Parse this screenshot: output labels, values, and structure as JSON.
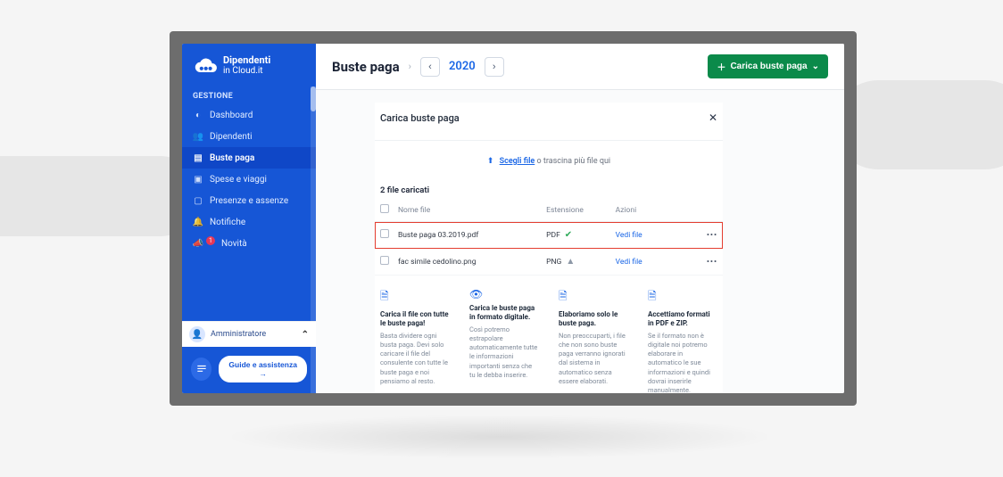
{
  "brand": {
    "name": "Dipendenti",
    "sub": "in Cloud.it"
  },
  "sidebar": {
    "section": "GESTIONE",
    "items": [
      {
        "label": "Dashboard"
      },
      {
        "label": "Dipendenti"
      },
      {
        "label": "Buste paga"
      },
      {
        "label": "Spese e viaggi"
      },
      {
        "label": "Presenze e assenze"
      },
      {
        "label": "Notifiche"
      },
      {
        "label": "Novità",
        "badge": "1"
      }
    ],
    "admin_label": "Amministratore",
    "guide_label": "Guide e assistenza →"
  },
  "header": {
    "page_title": "Buste paga",
    "year": "2020",
    "upload_button": "Carica buste paga"
  },
  "panel": {
    "title": "Carica buste paga",
    "choose_link": "Scegli file",
    "choose_rest": " o trascina più file qui",
    "files_count": "2 file caricati",
    "columns": {
      "name": "Nome file",
      "ext": "Estensione",
      "actions": "Azioni"
    },
    "files": [
      {
        "name": "Buste paga 03.2019.pdf",
        "ext": "PDF",
        "status": "ok",
        "action": "Vedi file"
      },
      {
        "name": "fac simile cedolino.png",
        "ext": "PNG",
        "status": "warn",
        "action": "Vedi file"
      }
    ],
    "info": [
      {
        "title": "Carica il file con tutte le buste paga!",
        "body": "Basta dividere ogni busta paga. Devi solo caricare il file del consulente con tutte le buste paga e noi pensiamo al resto."
      },
      {
        "title": "Carica le buste paga in formato digitale.",
        "body": "Così potremo estrapolare automaticamente tutte le informazioni importanti senza che tu le debba inserire."
      },
      {
        "title": "Elaboriamo solo le buste paga.",
        "body": "Non preoccuparti, i file che non sono buste paga verranno ignorati dal sistema in automatico senza essere elaborati."
      },
      {
        "title": "Accettiamo formati in PDF e ZIP.",
        "body": "Se il formato non è digitale noi potremo elaborare in automatico le sue informazioni e quindi dovrai inserirle manualmente."
      }
    ]
  }
}
